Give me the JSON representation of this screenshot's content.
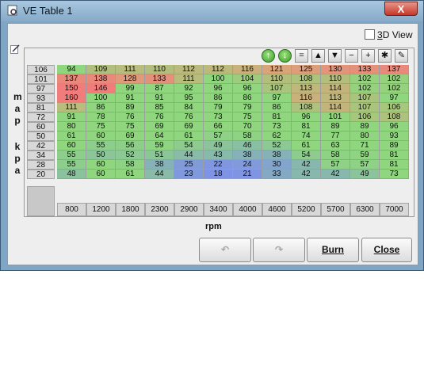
{
  "window": {
    "title": "VE Table 1",
    "close_glyph": "X"
  },
  "toggle_3d": {
    "label_prefix": "3",
    "label_rest": "D View",
    "checked": false
  },
  "toolbar": {
    "buttons": [
      {
        "name": "green-up-icon",
        "glyph": "↑"
      },
      {
        "name": "green-down-icon",
        "glyph": "↓"
      },
      {
        "name": "equals-button",
        "glyph": "="
      },
      {
        "name": "increase-button",
        "glyph": "▲"
      },
      {
        "name": "decrease-button",
        "glyph": "▼"
      },
      {
        "name": "minus-button",
        "glyph": "−"
      },
      {
        "name": "plus-button",
        "glyph": "+"
      },
      {
        "name": "multiply-button",
        "glyph": "✱"
      },
      {
        "name": "pen-icon",
        "glyph": "✎"
      }
    ]
  },
  "y_axis": {
    "label_top": "map",
    "label_bottom": "kpa"
  },
  "x_axis": {
    "label": "rpm"
  },
  "map_kpa": [
    "106",
    "101",
    "97",
    "93",
    "81",
    "72",
    "60",
    "50",
    "42",
    "34",
    "28",
    "20"
  ],
  "rpm": [
    "800",
    "1200",
    "1800",
    "2300",
    "2900",
    "3400",
    "4000",
    "4600",
    "5200",
    "5700",
    "6300",
    "7000"
  ],
  "table": [
    [
      94,
      109,
      111,
      110,
      112,
      112,
      116,
      121,
      125,
      130,
      133,
      137
    ],
    [
      137,
      138,
      128,
      133,
      111,
      100,
      104,
      110,
      108,
      110,
      102,
      102
    ],
    [
      150,
      146,
      99,
      87,
      92,
      96,
      96,
      107,
      113,
      114,
      102,
      102
    ],
    [
      160,
      100,
      91,
      91,
      95,
      86,
      86,
      97,
      116,
      113,
      107,
      97
    ],
    [
      111,
      86,
      89,
      85,
      84,
      79,
      79,
      86,
      108,
      114,
      107,
      106
    ],
    [
      91,
      78,
      76,
      76,
      76,
      73,
      75,
      81,
      96,
      101,
      106,
      108
    ],
    [
      80,
      75,
      75,
      69,
      69,
      66,
      70,
      73,
      81,
      89,
      89,
      96
    ],
    [
      61,
      60,
      69,
      64,
      61,
      57,
      58,
      62,
      74,
      77,
      80,
      93
    ],
    [
      60,
      55,
      56,
      59,
      54,
      49,
      46,
      52,
      61,
      63,
      71,
      89
    ],
    [
      55,
      50,
      52,
      51,
      44,
      43,
      38,
      38,
      54,
      58,
      59,
      81
    ],
    [
      55,
      60,
      58,
      38,
      25,
      22,
      24,
      30,
      42,
      57,
      57,
      81
    ],
    [
      48,
      60,
      61,
      44,
      23,
      18,
      21,
      33,
      42,
      42,
      49,
      73
    ]
  ],
  "buttons": {
    "undo_glyph": "↶",
    "redo_glyph": "↷",
    "burn_label": "Burn",
    "close_label": "Close"
  },
  "colors": {
    "high": "#f07c7c",
    "warm": "#d9a679",
    "mid": "#8fd67f",
    "low": "#7f93e6"
  }
}
